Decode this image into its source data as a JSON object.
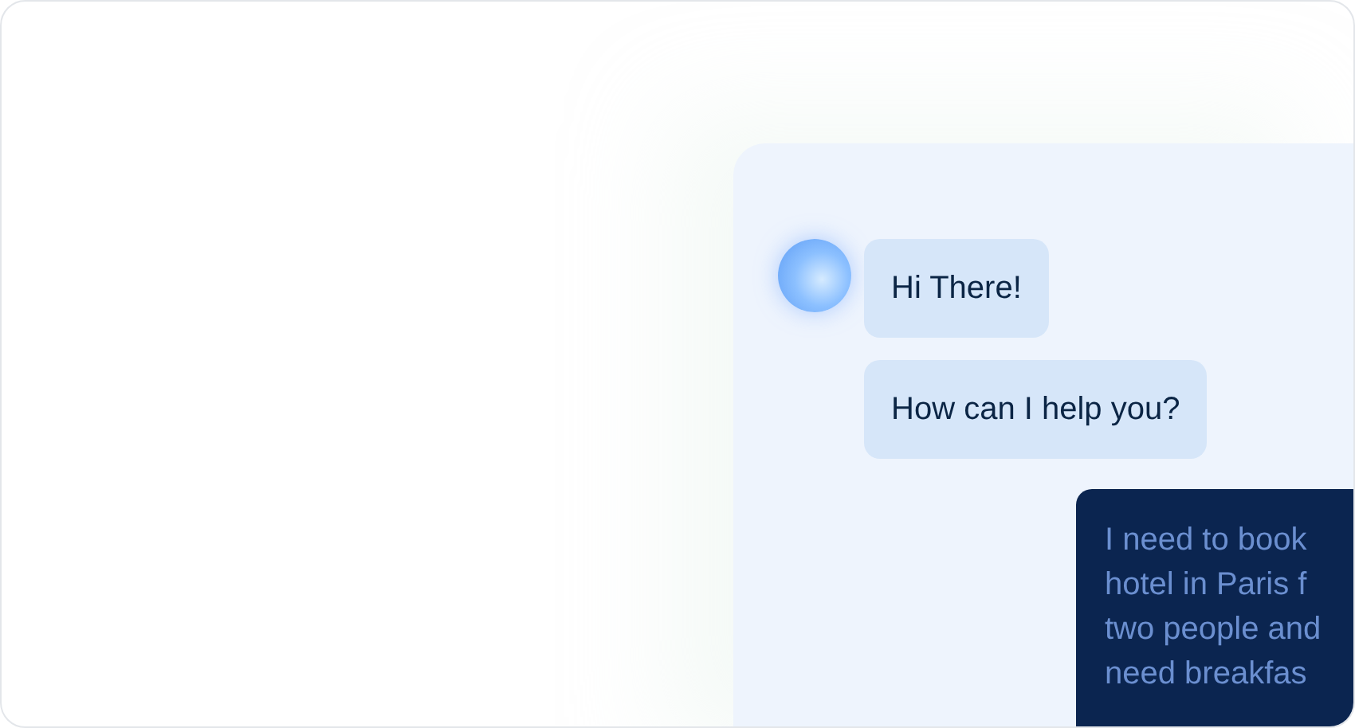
{
  "chat": {
    "messages": [
      {
        "kind": "bot",
        "lines": [
          "Hi There!"
        ]
      },
      {
        "kind": "bot",
        "lines": [
          "How can I help you?"
        ]
      },
      {
        "kind": "user",
        "lines": [
          "I need to book",
          "hotel in Paris f",
          "two people and",
          "need breakfas"
        ]
      }
    ]
  }
}
